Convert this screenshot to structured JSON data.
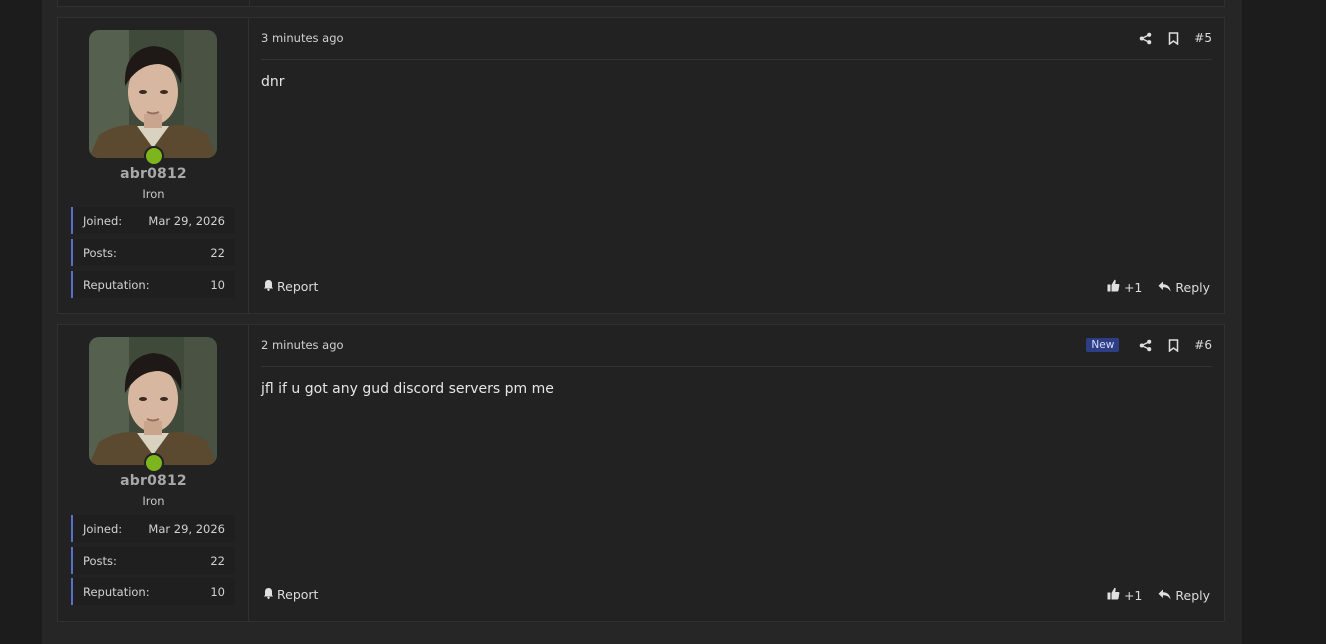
{
  "posts": [
    {
      "time": "3 minutes ago",
      "number": "#5",
      "is_new": false,
      "new_label": "",
      "content": "dnr",
      "user": {
        "name": "abr0812",
        "title": "Iron",
        "online": true,
        "stats": [
          {
            "label": "Joined:",
            "value": "Mar 29, 2026"
          },
          {
            "label": "Posts:",
            "value": "22"
          },
          {
            "label": "Reputation:",
            "value": "10"
          }
        ]
      },
      "actions": {
        "report": "Report",
        "like": "+1",
        "reply": "Reply"
      }
    },
    {
      "time": "2 minutes ago",
      "number": "#6",
      "is_new": true,
      "new_label": "New",
      "content": "jfl if u got any gud discord servers pm me",
      "user": {
        "name": "abr0812",
        "title": "Iron",
        "online": true,
        "stats": [
          {
            "label": "Joined:",
            "value": "Mar 29, 2026"
          },
          {
            "label": "Posts:",
            "value": "22"
          },
          {
            "label": "Reputation:",
            "value": "10"
          }
        ]
      },
      "actions": {
        "report": "Report",
        "like": "+1",
        "reply": "Reply"
      }
    }
  ],
  "colors": {
    "online": "#7db61c",
    "stat_accent": "#5a6fc8",
    "new_badge": "#2d3e86"
  },
  "icons": [
    "share-icon",
    "bookmark-icon",
    "bell-icon",
    "thumbs-up-icon",
    "reply-arrow-icon"
  ]
}
